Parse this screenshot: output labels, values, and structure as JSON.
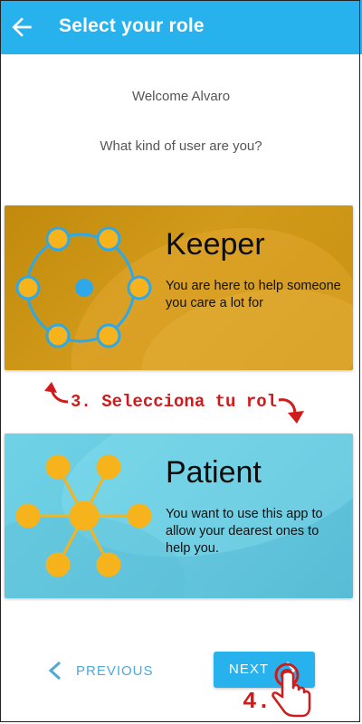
{
  "app_bar": {
    "title": "Select your role",
    "back_icon": "arrow-left-icon",
    "color": "#27b2ee"
  },
  "welcome_text": "Welcome Alvaro",
  "question_text": "What kind of user are you?",
  "roles": [
    {
      "title": "Keeper",
      "description": "You are here to help someone you care a lot for",
      "color": "#c8920f",
      "icon": "circle-network-icon"
    },
    {
      "title": "Patient",
      "description": "You want to use this app to allow your dearest ones to help you.",
      "color": "#66c8df",
      "icon": "star-network-icon"
    }
  ],
  "annotations": {
    "step3": "3. Selecciona tu rol",
    "step4": "4.",
    "color": "#d11a1a"
  },
  "nav": {
    "previous_label": "PREVIOUS",
    "next_label": "NEXT"
  }
}
